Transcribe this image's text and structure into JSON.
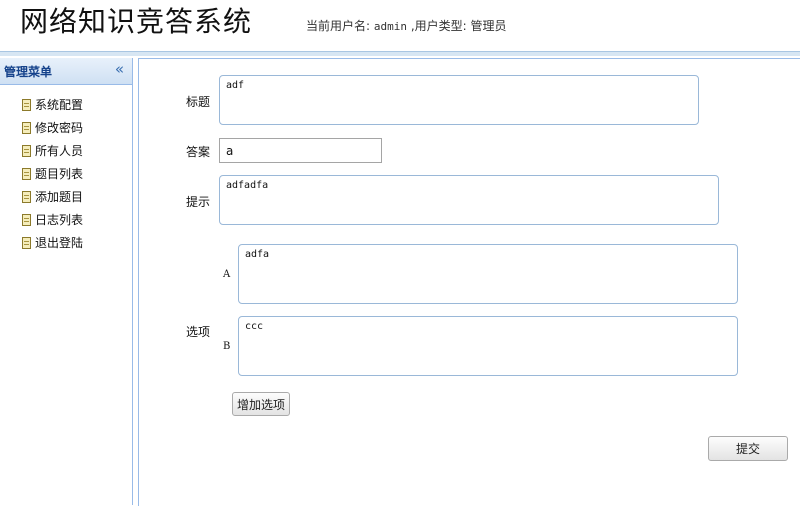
{
  "header": {
    "title": "网络知识竞答系统",
    "user_label": "当前用户名:",
    "username": "admin",
    "role_label": ",用户类型:",
    "role": "管理员"
  },
  "sidebar": {
    "title": "管理菜单",
    "collapse_icon": "«",
    "items": [
      {
        "label": "系统配置"
      },
      {
        "label": "修改密码"
      },
      {
        "label": "所有人员"
      },
      {
        "label": "题目列表"
      },
      {
        "label": "添加题目"
      },
      {
        "label": "日志列表"
      },
      {
        "label": "退出登陆"
      }
    ]
  },
  "form": {
    "title_label": "标题",
    "title_value": "adf",
    "answer_label": "答案",
    "answer_value": "a",
    "hint_label": "提示",
    "hint_value": "adfadfa",
    "options_label": "选项",
    "options": [
      {
        "letter": "A",
        "value": "adfa"
      },
      {
        "letter": "B",
        "value": "ccc"
      }
    ],
    "add_option_button": "增加选项",
    "submit_button": "提交"
  }
}
